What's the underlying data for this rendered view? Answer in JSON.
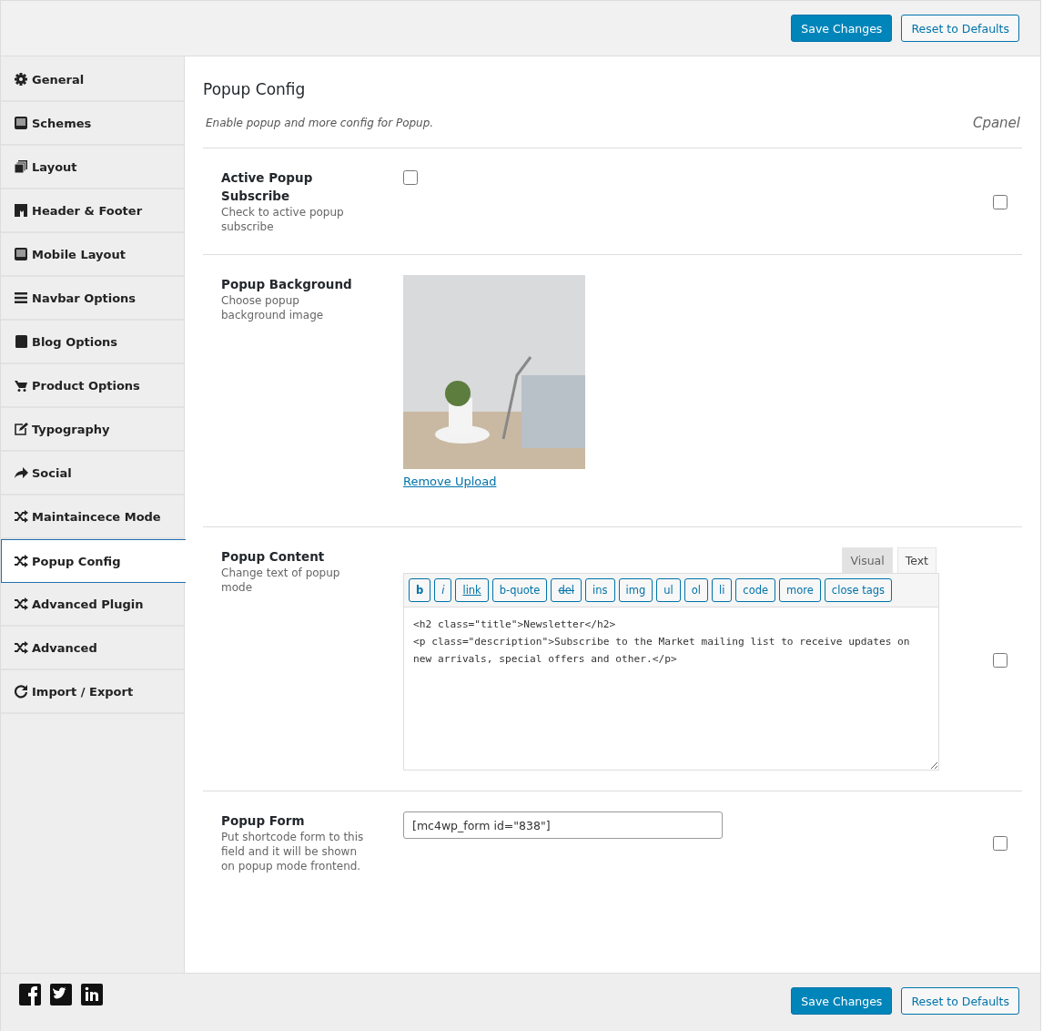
{
  "header": {
    "buttons": [
      {
        "label": "Save Changes",
        "kind": "primary"
      },
      {
        "label": "Reset to Defaults",
        "kind": "secondary"
      }
    ]
  },
  "sidebar": {
    "items": [
      {
        "label": "General",
        "kind": "gear",
        "selected": false
      },
      {
        "label": "Schemes",
        "kind": "monitor",
        "selected": false
      },
      {
        "label": "Layout",
        "kind": "copy",
        "selected": false
      },
      {
        "label": "Header & Footer",
        "kind": "bookmark",
        "selected": false
      },
      {
        "label": "Mobile Layout",
        "kind": "monitor",
        "selected": false
      },
      {
        "label": "Navbar Options",
        "kind": "bars",
        "selected": false
      },
      {
        "label": "Blog Options",
        "kind": "book",
        "selected": false
      },
      {
        "label": "Product Options",
        "kind": "cart",
        "selected": false
      },
      {
        "label": "Typography",
        "kind": "edit",
        "selected": false
      },
      {
        "label": "Social",
        "kind": "share",
        "selected": false
      },
      {
        "label": "Maintaincece Mode",
        "kind": "shuffle",
        "selected": false
      },
      {
        "label": "Popup Config",
        "kind": "shuffle",
        "selected": true
      },
      {
        "label": "Advanced Plugin",
        "kind": "shuffle",
        "selected": false
      },
      {
        "label": "Advanced",
        "kind": "shuffle",
        "selected": false
      },
      {
        "label": "Import / Export",
        "kind": "refresh",
        "selected": false
      }
    ]
  },
  "section": {
    "title": "Popup Config",
    "description": "Enable popup and more config for Popup.",
    "badge": "Cpanel"
  },
  "rows": [
    {
      "kind": "checkbox",
      "title": "Active Popup Subscribe",
      "hint": "Check to active popup subscribe",
      "checked": false,
      "side_checked": false
    },
    {
      "kind": "image",
      "title": "Popup Background",
      "hint": "Choose popup background image",
      "link": "Remove Upload"
    },
    {
      "kind": "editor",
      "title": "Popup Content",
      "hint": "Change text of popup mode",
      "tabs": [
        {
          "label": "Visual",
          "selected": false
        },
        {
          "label": "Text",
          "selected": true
        }
      ],
      "toolbar": [
        {
          "label": "b",
          "kind": "bold"
        },
        {
          "label": "i",
          "kind": "italic"
        },
        {
          "label": "link",
          "kind": "underline"
        },
        {
          "label": "b-quote",
          "kind": "plain"
        },
        {
          "label": "del",
          "kind": "strike"
        },
        {
          "label": "ins",
          "kind": "plain"
        },
        {
          "label": "img",
          "kind": "plain"
        },
        {
          "label": "ul",
          "kind": "plain"
        },
        {
          "label": "ol",
          "kind": "plain"
        },
        {
          "label": "li",
          "kind": "plain"
        },
        {
          "label": "code",
          "kind": "plain"
        },
        {
          "label": "more",
          "kind": "plain"
        },
        {
          "label": "close tags",
          "kind": "plain"
        }
      ],
      "value": "<h2 class=\"title\">Newsletter</h2>\n<p class=\"description\">Subscribe to the Market mailing list to receive updates on new arrivals, special offers and other.</p>",
      "side_checked": false
    },
    {
      "kind": "text",
      "title": "Popup Form",
      "hint": "Put shortcode form to this field and it will be shown on popup mode frontend.",
      "value": "[mc4wp_form id=\"838\"]",
      "side_checked": false
    }
  ],
  "footer": {
    "social": [
      {
        "kind": "facebook"
      },
      {
        "kind": "twitter"
      },
      {
        "kind": "linkedin"
      }
    ],
    "buttons": [
      {
        "label": "Save Changes",
        "kind": "primary"
      },
      {
        "label": "Reset to Defaults",
        "kind": "secondary"
      }
    ]
  }
}
